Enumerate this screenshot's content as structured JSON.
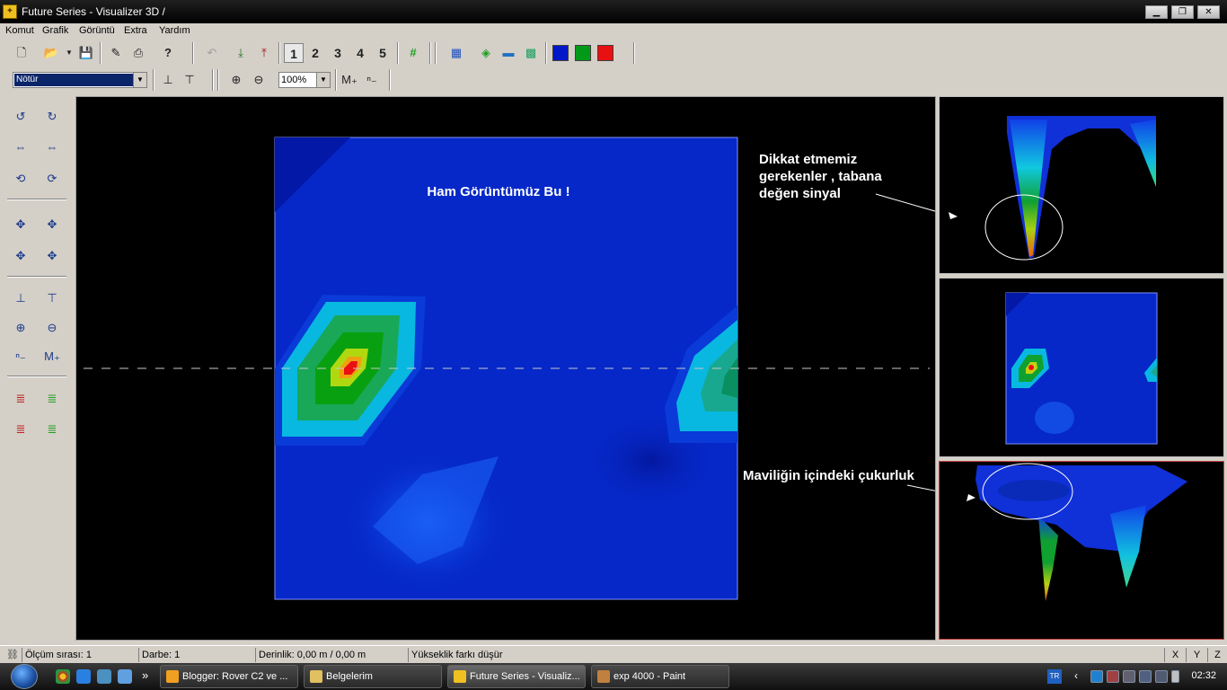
{
  "window": {
    "title": "Future Series - Visualizer 3D /",
    "app_icon": "visualizer-app-icon"
  },
  "menu": [
    "Komut",
    "Grafik",
    "Görüntü",
    "Extra",
    "Yardım"
  ],
  "toolbar1": {
    "view_numbers": [
      "1",
      "2",
      "3",
      "4",
      "5"
    ],
    "color_buttons": [
      "#0018c8",
      "#009a18",
      "#e81010"
    ]
  },
  "toolbar2": {
    "filter_value": "Nötür",
    "zoom_value": "100%"
  },
  "main": {
    "annotation": "Ham Görüntümüz Bu !"
  },
  "side_annotations": {
    "top": [
      "Dikkat etmemiz",
      "gerekenler , tabana",
      "değen sinyal"
    ],
    "bottom": "Maviliğin içindeki çukurluk"
  },
  "status": {
    "measure": "Ölçüm sırası: 1",
    "pulse": "Darbe: 1",
    "depth": "Derinlik: 0,00 m / 0,00 m",
    "mode": "Yükseklik farkı düşür",
    "axes": [
      "X",
      "Y",
      "Z"
    ]
  },
  "taskbar": {
    "tasks": [
      "Blogger: Rover C2 ve ...",
      "Belgelerim",
      "Future Series - Visualiz...",
      "exp 4000 - Paint"
    ],
    "more": "»",
    "lang": "TR",
    "clock": "02:32"
  }
}
